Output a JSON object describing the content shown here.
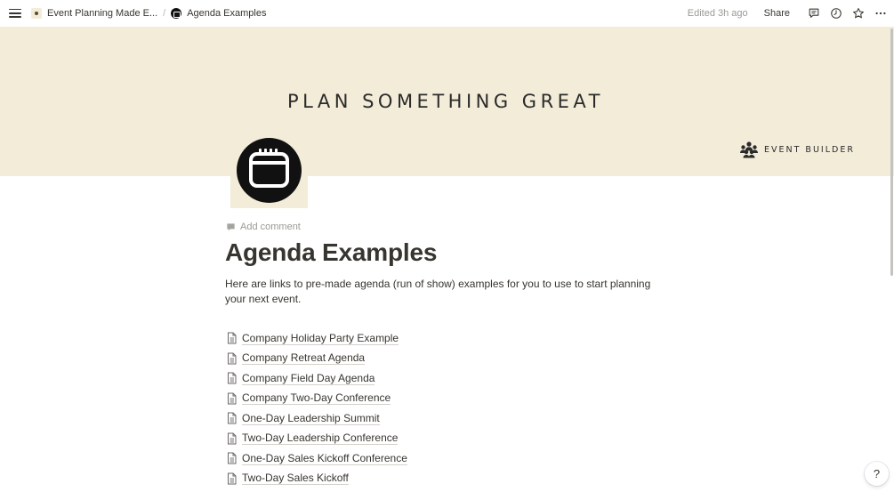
{
  "topbar": {
    "breadcrumbs": [
      {
        "label": "Event Planning Made E..."
      },
      {
        "label": "Agenda Examples"
      }
    ],
    "separator": "/",
    "edited": "Edited 3h ago",
    "share_label": "Share",
    "icons": [
      "menu-icon",
      "comments-icon",
      "history-icon",
      "favorite-star-icon",
      "more-icon"
    ]
  },
  "cover": {
    "title": "PLAN SOMETHING GREAT",
    "brand": "EVENT BUILDER",
    "background": "#f3ecd9"
  },
  "page": {
    "add_comment": "Add comment",
    "title": "Agenda Examples",
    "description": "Here are links to pre-made agenda (run of show) examples for you to use to start planning your next event.",
    "links": [
      {
        "label": "Company Holiday Party Example"
      },
      {
        "label": "Company Retreat Agenda"
      },
      {
        "label": "Company Field Day Agenda"
      },
      {
        "label": "Company Two-Day Conference"
      },
      {
        "label": "One-Day Leadership Summit"
      },
      {
        "label": "Two-Day Leadership Conference"
      },
      {
        "label": "One-Day Sales Kickoff Conference"
      },
      {
        "label": "Two-Day Sales Kickoff"
      }
    ]
  },
  "help_label": "?"
}
